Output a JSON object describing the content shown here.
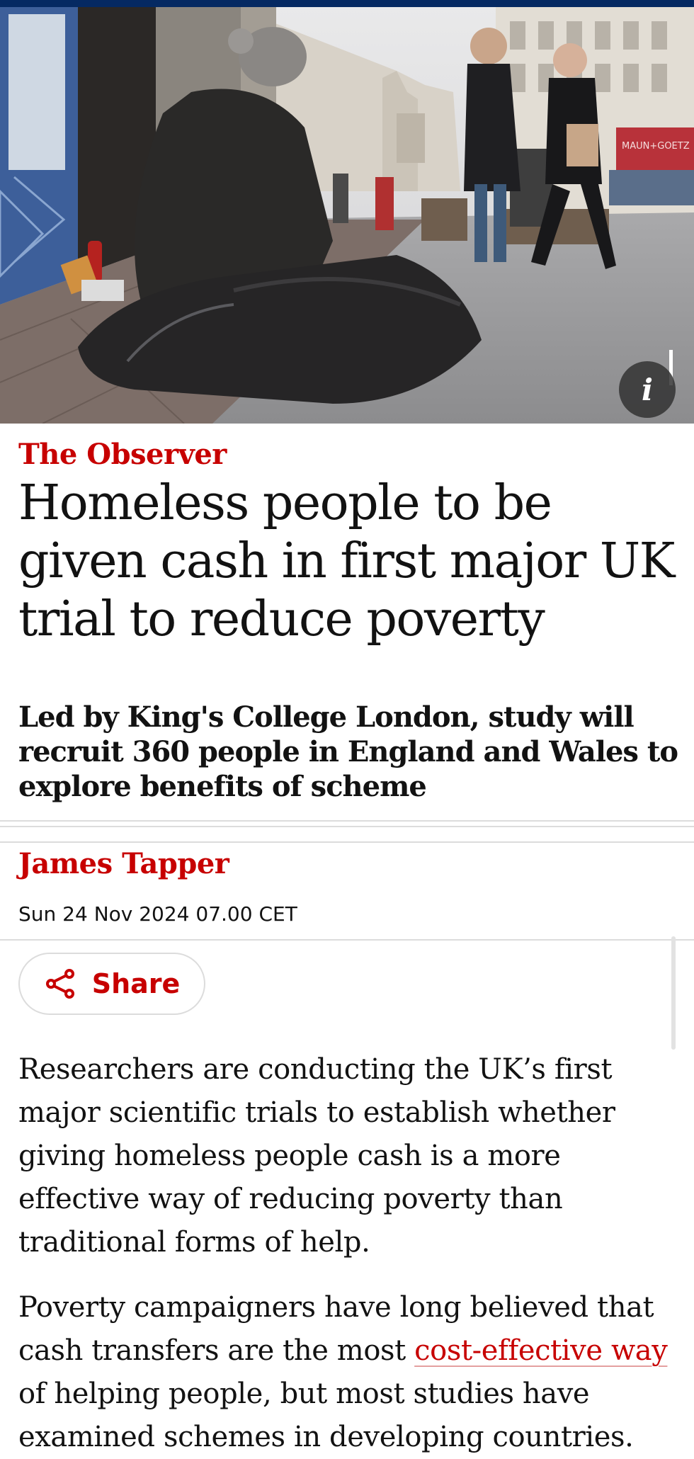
{
  "hero": {
    "shop_sign": "MAUN+GOETZ",
    "info_button": "i"
  },
  "article": {
    "kicker": "The Observer",
    "headline": "Homeless people to be given cash in first major UK trial to reduce poverty",
    "standfirst": "Led by King's College London, study will recruit 360 people in England and Wales to explore benefits of scheme",
    "byline": "James Tapper",
    "date": "Sun 24 Nov 2024 07.00 CET",
    "share_label": "Share",
    "paragraph1": "Researchers are conducting the UK’s first major scientific trials to establish whether giving homeless people cash is a more effective way of reducing poverty than traditional forms of help.",
    "paragraph2_before": "Poverty campaigners have long believed that cash transfers are the most ",
    "paragraph2_link": "cost-effective way",
    "paragraph2_after": " of helping people, but most studies have examined schemes in developing countries."
  },
  "colors": {
    "accent": "#c70000",
    "masthead": "#052962",
    "text": "#121212"
  }
}
